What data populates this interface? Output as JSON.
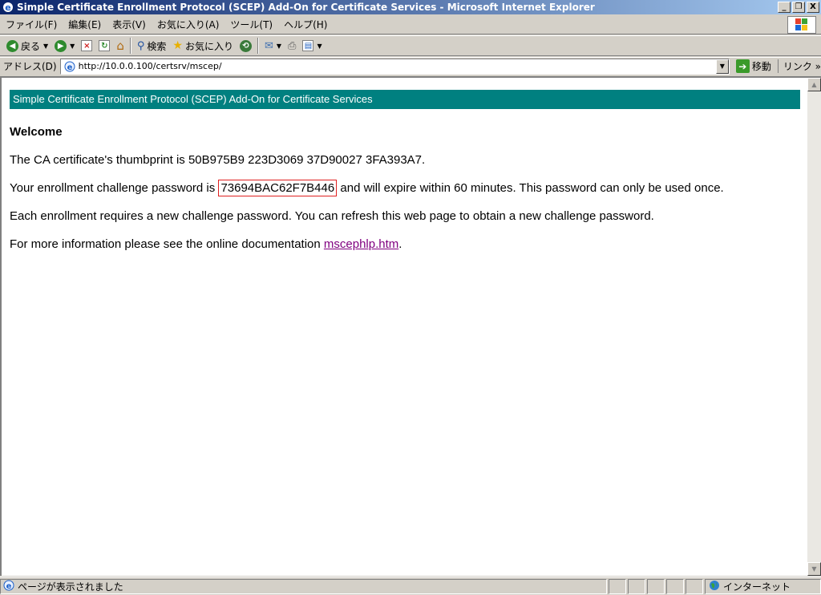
{
  "window": {
    "title": "Simple Certificate Enrollment Protocol (SCEP) Add-On for Certificate Services - Microsoft Internet Explorer",
    "minimize": "_",
    "maximize": "§",
    "close": "X"
  },
  "menu": {
    "items": [
      "ファイル(F)",
      "編集(E)",
      "表示(V)",
      "お気に入り(A)",
      "ツール(T)",
      "ヘルプ(H)"
    ]
  },
  "toolbar": {
    "back_label": "戻る",
    "search_label": "検索",
    "favorites_label": "お気に入り"
  },
  "address": {
    "label": "アドレス(D)",
    "url": "http://10.0.0.100/certsrv/mscep/",
    "go_label": "移動",
    "links_label": "リンク »"
  },
  "page": {
    "banner": "Simple Certificate Enrollment Protocol (SCEP) Add-On for Certificate Services",
    "welcome": "Welcome",
    "thumbprint_text": "The CA certificate's thumbprint is 50B975B9 223D3069 37D90027 3FA393A7.",
    "password_prefix": "Your enrollment challenge password is ",
    "password_value": "73694BAC62F7B446",
    "password_suffix": " and will expire within 60 minutes.   This password can only be used once.",
    "refresh_text": "Each enrollment requires a new challenge password.   You can refresh this web page to obtain a new challenge password.",
    "docs_prefix": "For more information please see the online documentation ",
    "docs_link": "mscephlp.htm",
    "docs_suffix": "."
  },
  "status": {
    "text": "ページが表示されました",
    "zone": "インターネット"
  },
  "colors": {
    "banner_bg": "#008080",
    "highlight_border": "#e02020",
    "visited_link": "#800080"
  }
}
